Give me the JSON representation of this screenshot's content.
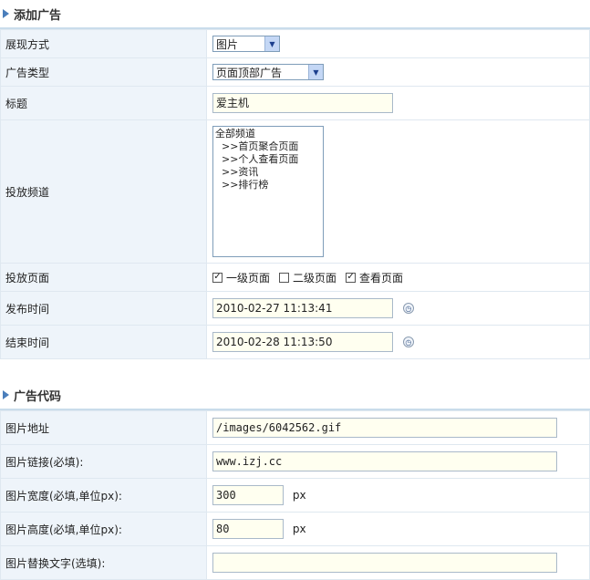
{
  "section1": {
    "title": "添加广告"
  },
  "display_mode": {
    "label": "展现方式",
    "value": "图片"
  },
  "ad_type": {
    "label": "广告类型",
    "value": "页面顶部广告"
  },
  "title_field": {
    "label": "标题",
    "value": "爱主机"
  },
  "channel": {
    "label": "投放频道",
    "options": [
      "全部频道",
      "  >>首页聚合页面",
      "  >>个人查看页面",
      "  >>资讯",
      "  >>排行榜"
    ]
  },
  "pages": {
    "label": "投放页面",
    "options": [
      {
        "label": "一级页面",
        "checked": true
      },
      {
        "label": "二级页面",
        "checked": false
      },
      {
        "label": "查看页面",
        "checked": true
      }
    ]
  },
  "publish_time": {
    "label": "发布时间",
    "value": "2010-02-27 11:13:41"
  },
  "end_time": {
    "label": "结束时间",
    "value": "2010-02-28 11:13:50"
  },
  "section2": {
    "title": "广告代码"
  },
  "image_url": {
    "label": "图片地址",
    "value": "/images/6042562.gif"
  },
  "image_link": {
    "label": "图片链接(必填):",
    "value": "www.izj.cc"
  },
  "image_width": {
    "label": "图片宽度(必填,单位px):",
    "value": "300",
    "unit": "px"
  },
  "image_height": {
    "label": "图片高度(必填,单位px):",
    "value": "80",
    "unit": "px"
  },
  "image_alt": {
    "label": "图片替换文字(选填):",
    "value": ""
  }
}
